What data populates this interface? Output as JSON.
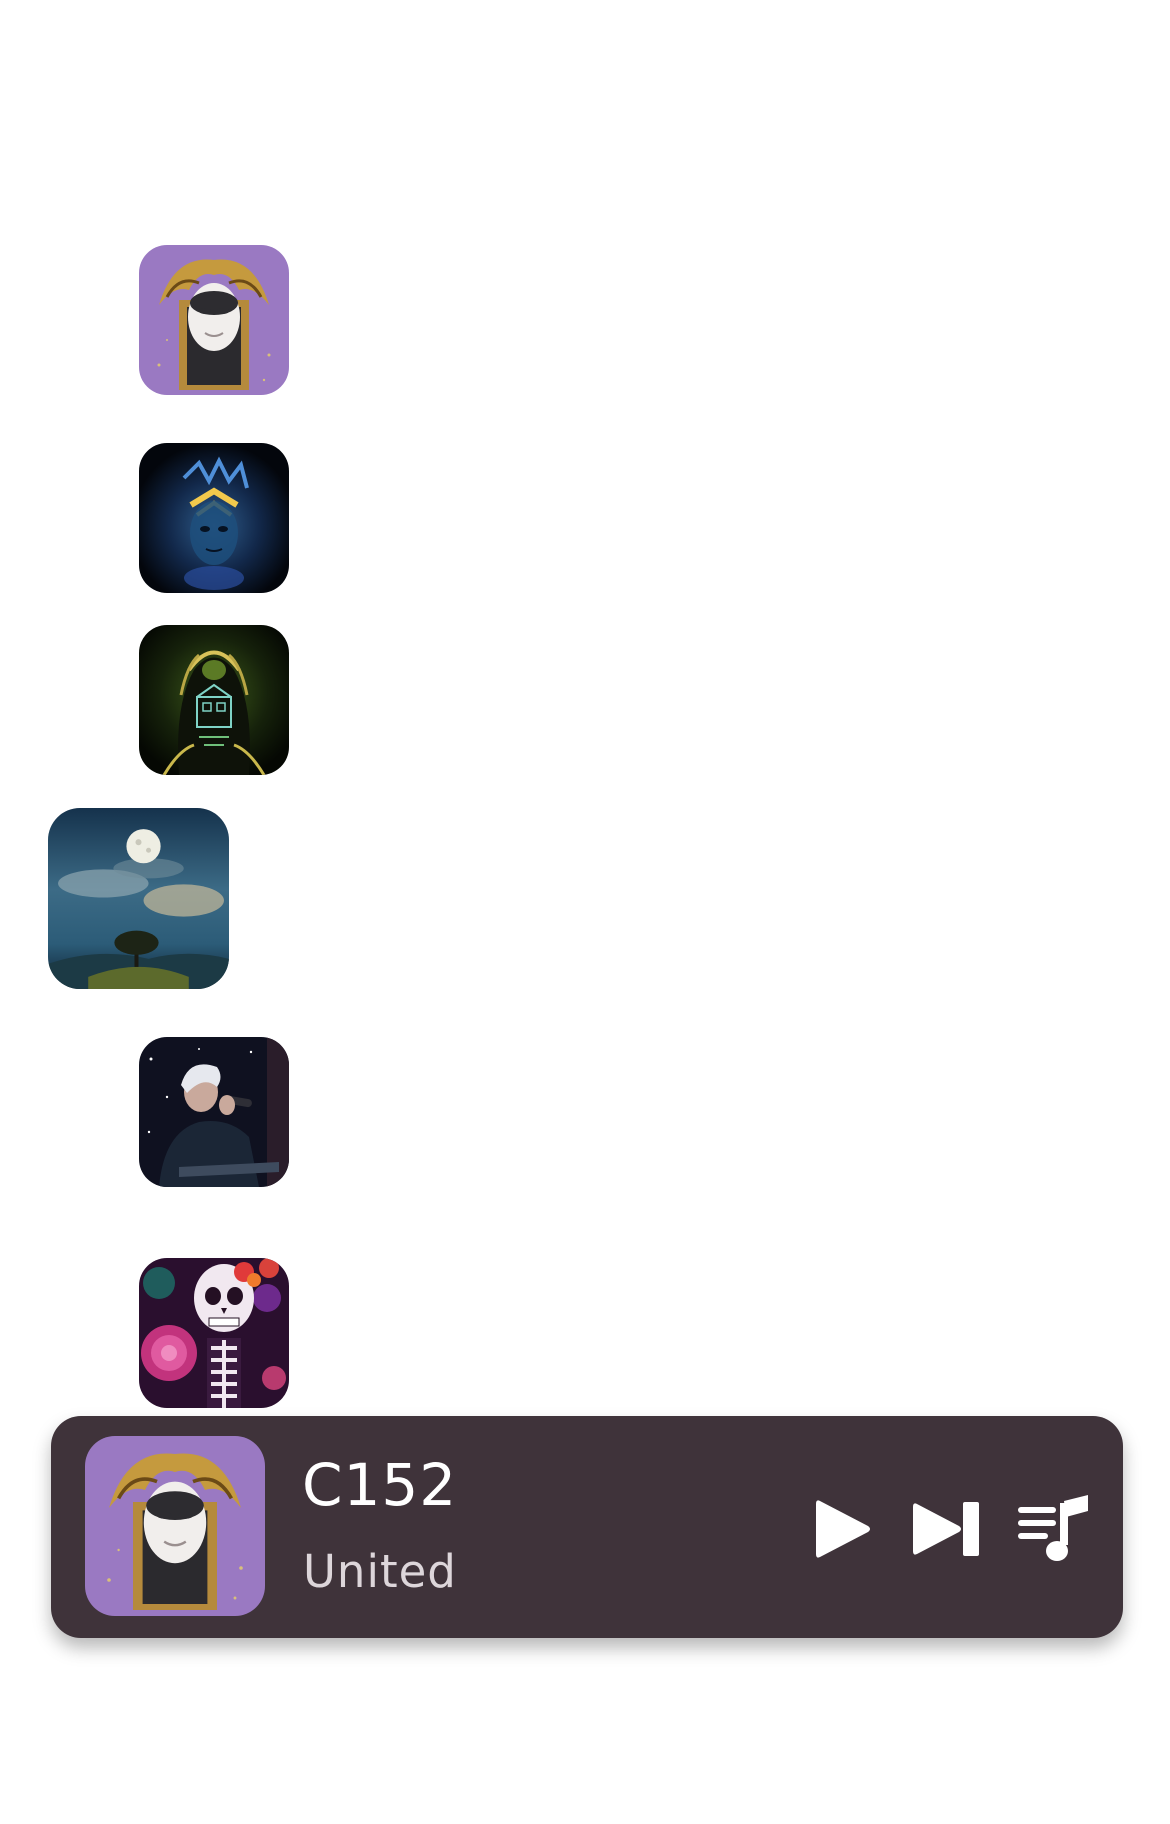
{
  "player": {
    "title": "C152",
    "artist": "United",
    "play_icon": "play-icon",
    "next_icon": "skip-forward-icon",
    "queue_icon": "queue-music-icon",
    "background_color": "#3f333a"
  },
  "list": {
    "artworks": [
      {
        "icon": "jester-mask-artwork"
      },
      {
        "icon": "blue-glowing-face-artwork"
      },
      {
        "icon": "green-hooded-figure-artwork"
      },
      {
        "icon": "moonlit-tree-artwork"
      },
      {
        "icon": "singer-microphone-artwork"
      },
      {
        "icon": "sugar-skull-artwork"
      }
    ]
  }
}
